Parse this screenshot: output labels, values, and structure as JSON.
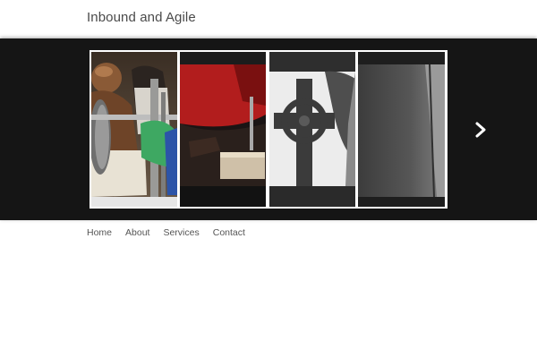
{
  "site": {
    "title": "Inbound and Agile"
  },
  "banner": {
    "background_color": "#151515",
    "frame_color": "#ffffff",
    "panels": [
      {
        "icon": "weightlifter-photo"
      },
      {
        "icon": "red-workshop-photo"
      },
      {
        "icon": "celtic-cross-photo"
      },
      {
        "icon": "stone-wall-photo"
      }
    ],
    "next_icon": "chevron-right-icon"
  },
  "nav": {
    "items": [
      {
        "label": "Home"
      },
      {
        "label": "About"
      },
      {
        "label": "Services"
      },
      {
        "label": "Contact"
      }
    ]
  }
}
